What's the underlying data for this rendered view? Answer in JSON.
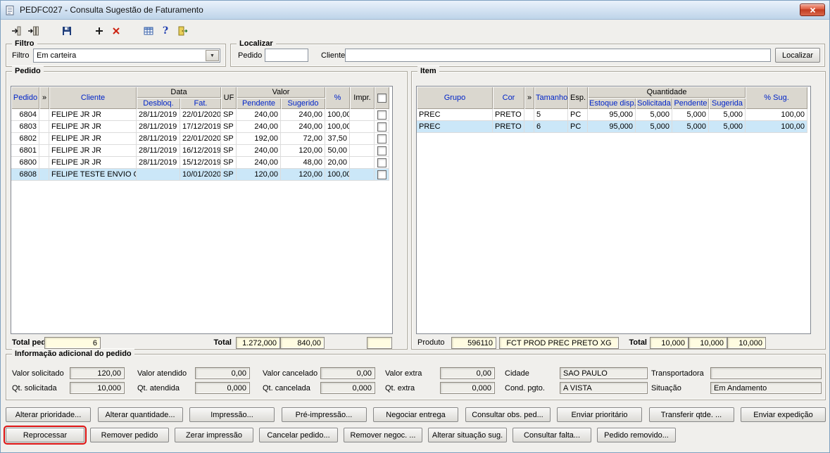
{
  "window": {
    "title": "PEDFC027 - Consulta Sugestão de Faturamento"
  },
  "toolbar": {
    "icons": [
      "close-window-icon",
      "close-all-windows-icon",
      "save-icon",
      "add-icon",
      "delete-icon",
      "grid-icon",
      "help-icon",
      "exit-icon"
    ]
  },
  "filtro": {
    "legend": "Filtro",
    "label": "Filtro",
    "value": "Em carteira"
  },
  "localizar": {
    "legend": "Localizar",
    "pedido_label": "Pedido",
    "pedido_value": "",
    "cliente_label": "Cliente",
    "cliente_value": "",
    "button_label": "Localizar"
  },
  "pedido": {
    "legend": "Pedido",
    "headers": {
      "pedido": "Pedido",
      "chevron": "»",
      "cliente": "Cliente",
      "data": "Data",
      "desbloq": "Desbloq.",
      "fat": "Fat.",
      "uf": "UF",
      "valor": "Valor",
      "pendente": "Pendente",
      "sugerido": "Sugerido",
      "pct": "%",
      "impr": "Impr."
    },
    "rows": [
      {
        "pedido": "6804",
        "cliente": "FELIPE JR JR",
        "desbloq": "28/11/2019",
        "fat": "22/01/2020",
        "uf": "SP",
        "pendente": "240,00",
        "sugerido": "240,00",
        "pct": "100,00",
        "impr": ""
      },
      {
        "pedido": "6803",
        "cliente": "FELIPE JR JR",
        "desbloq": "28/11/2019",
        "fat": "17/12/2019",
        "uf": "SP",
        "pendente": "240,00",
        "sugerido": "240,00",
        "pct": "100,00",
        "impr": ""
      },
      {
        "pedido": "6802",
        "cliente": "FELIPE JR JR",
        "desbloq": "28/11/2019",
        "fat": "22/01/2020",
        "uf": "SP",
        "pendente": "192,00",
        "sugerido": "72,00",
        "pct": "37,50",
        "impr": ""
      },
      {
        "pedido": "6801",
        "cliente": "FELIPE JR JR",
        "desbloq": "28/11/2019",
        "fat": "16/12/2019",
        "uf": "SP",
        "pendente": "240,00",
        "sugerido": "120,00",
        "pct": "50,00",
        "impr": ""
      },
      {
        "pedido": "6800",
        "cliente": "FELIPE JR JR",
        "desbloq": "28/11/2019",
        "fat": "15/12/2019",
        "uf": "SP",
        "pendente": "240,00",
        "sugerido": "48,00",
        "pct": "20,00",
        "impr": ""
      },
      {
        "pedido": "6808",
        "cliente": "FELIPE TESTE ENVIO C",
        "desbloq": "",
        "fat": "10/01/2020",
        "uf": "SP",
        "pendente": "120,00",
        "sugerido": "120,00",
        "pct": "100,00",
        "impr": ""
      }
    ],
    "footer": {
      "total_ped_label": "Total ped.",
      "total_ped_value": "6",
      "total_label": "Total",
      "total_pendente": "1.272,000",
      "total_sugerido": "840,00"
    }
  },
  "item": {
    "legend": "Item",
    "headers": {
      "grupo": "Grupo",
      "cor": "Cor",
      "chevron": "»",
      "tamanho": "Tamanho",
      "esp": "Esp.",
      "quantidade": "Quantidade",
      "estoque": "Estoque disp.",
      "solicitada": "Solicitada",
      "pendente": "Pendente",
      "sugerida": "Sugerida",
      "pct_sug": "% Sug."
    },
    "rows": [
      {
        "grupo": "PREC",
        "cor": "PRETO",
        "tamanho": "5",
        "esp": "PC",
        "estoque": "95,000",
        "solicitada": "5,000",
        "pendente": "5,000",
        "sugerida": "5,000",
        "pct_sug": "100,00"
      },
      {
        "grupo": "PREC",
        "cor": "PRETO",
        "tamanho": "6",
        "esp": "PC",
        "estoque": "95,000",
        "solicitada": "5,000",
        "pendente": "5,000",
        "sugerida": "5,000",
        "pct_sug": "100,00"
      }
    ],
    "footer": {
      "produto_label": "Produto",
      "produto_codigo": "596110",
      "produto_descricao": "FCT PROD PREC PRETO XG",
      "total_label": "Total",
      "total_solicitada": "10,000",
      "total_pendente": "10,000",
      "total_sugerida": "10,000"
    }
  },
  "info": {
    "legend": "Informação adicional do pedido",
    "valor_solicitado": {
      "label": "Valor solicitado",
      "value": "120,00"
    },
    "qt_solicitada": {
      "label": "Qt. solicitada",
      "value": "10,000"
    },
    "valor_atendido": {
      "label": "Valor atendido",
      "value": "0,00"
    },
    "qt_atendida": {
      "label": "Qt. atendida",
      "value": "0,000"
    },
    "valor_cancelado": {
      "label": "Valor cancelado",
      "value": "0,00"
    },
    "qt_cancelada": {
      "label": "Qt. cancelada",
      "value": "0,000"
    },
    "valor_extra": {
      "label": "Valor extra",
      "value": "0,00"
    },
    "qt_extra": {
      "label": "Qt. extra",
      "value": "0,000"
    },
    "cidade": {
      "label": "Cidade",
      "value": "SAO PAULO"
    },
    "cond_pgto": {
      "label": "Cond. pgto.",
      "value": "A VISTA"
    },
    "transportadora": {
      "label": "Transportadora",
      "value": ""
    },
    "situacao": {
      "label": "Situação",
      "value": "Em Andamento"
    }
  },
  "actions": {
    "row1": [
      "Alterar prioridade...",
      "Alterar quantidade...",
      "Impressão...",
      "Pré-impressão...",
      "Negociar entrega",
      "Consultar obs. ped...",
      "Enviar prioritário",
      "Transferir qtde. ...",
      "Enviar expedição"
    ],
    "row2": [
      "Reprocessar",
      "Remover pedido",
      "Zerar impressão",
      "Cancelar pedido...",
      "Remover negoc. ...",
      "Alterar situação sug.",
      "Consultar falta...",
      "Pedido removido..."
    ]
  }
}
